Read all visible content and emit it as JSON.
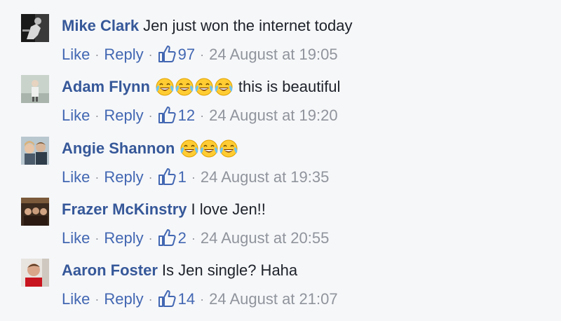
{
  "comments": [
    {
      "author": "Mike Clark",
      "text": "Jen just won the internet today",
      "emoji_count": 0,
      "like_label": "Like",
      "reply_label": "Reply",
      "likes": "97",
      "timestamp": "24 August at 19:05"
    },
    {
      "author": "Adam Flynn",
      "text": "this is beautiful",
      "emoji_count": 4,
      "like_label": "Like",
      "reply_label": "Reply",
      "likes": "12",
      "timestamp": "24 August at 19:20"
    },
    {
      "author": "Angie Shannon",
      "text": "",
      "emoji_count": 3,
      "like_label": "Like",
      "reply_label": "Reply",
      "likes": "1",
      "timestamp": "24 August at 19:35"
    },
    {
      "author": "Frazer McKinstry",
      "text": "I love Jen!!",
      "emoji_count": 0,
      "like_label": "Like",
      "reply_label": "Reply",
      "likes": "2",
      "timestamp": "24 August at 20:55"
    },
    {
      "author": "Aaron Foster",
      "text": "Is Jen single? Haha",
      "emoji_count": 0,
      "like_label": "Like",
      "reply_label": "Reply",
      "likes": "14",
      "timestamp": "24 August at 21:07"
    }
  ],
  "colors": {
    "author": "#365899",
    "link": "#4267b2",
    "meta": "#90949c",
    "text": "#1d2129",
    "background": "#f6f7f9"
  },
  "icons": {
    "like": "thumbs-up-icon",
    "emoji": "tears-of-joy-emoji-icon"
  }
}
